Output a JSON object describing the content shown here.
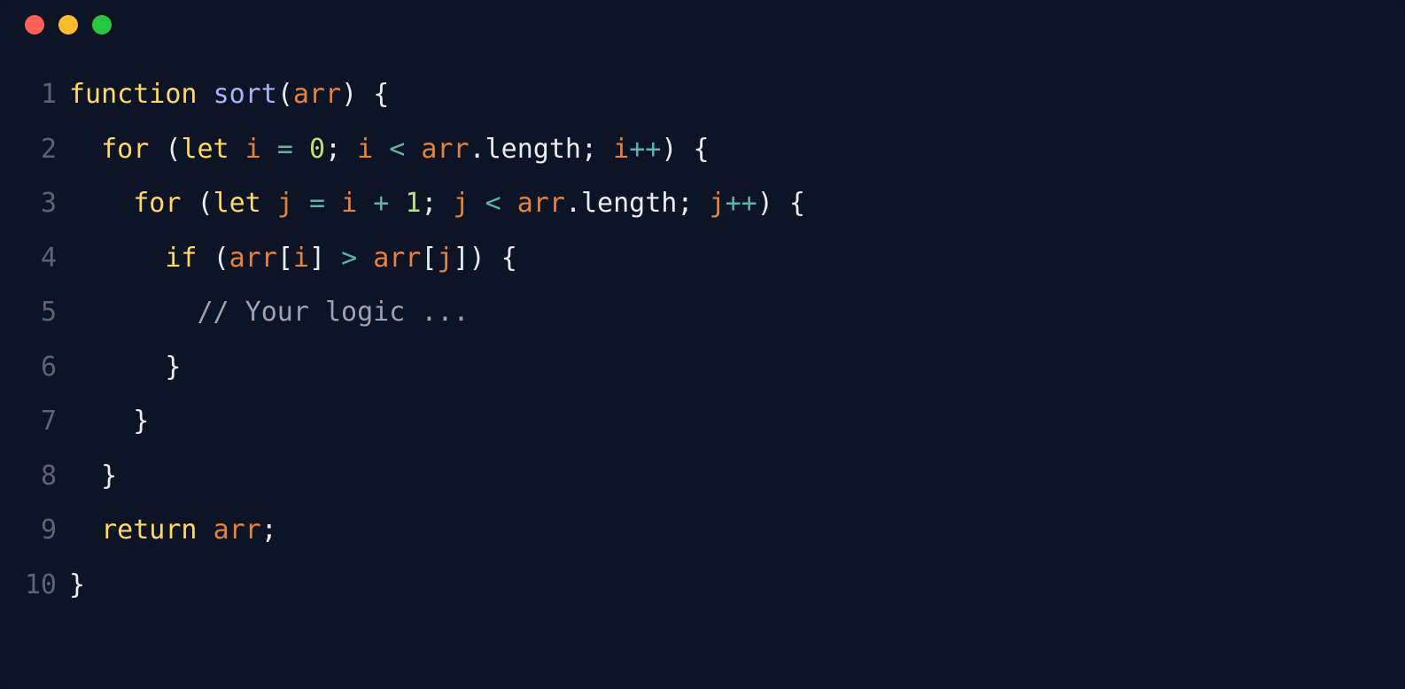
{
  "traffic": {
    "red": "#ff5f57",
    "yellow": "#febc2e",
    "green": "#28c840"
  },
  "lineNumbers": [
    "1",
    "2",
    "3",
    "4",
    "5",
    "6",
    "7",
    "8",
    "9",
    "10"
  ],
  "code": {
    "l1": {
      "function": "function",
      "sp1": " ",
      "name": "sort",
      "lp": "(",
      "arg": "arr",
      "rp": ")",
      "sp2": " ",
      "brace": "{"
    },
    "l2": {
      "indent": "  ",
      "for": "for",
      "sp1": " ",
      "lp": "(",
      "let": "let",
      "sp2": " ",
      "i1": "i",
      "sp3": " ",
      "eq": "=",
      "sp4": " ",
      "zero": "0",
      "semi1": ";",
      "sp5": " ",
      "i2": "i",
      "sp6": " ",
      "lt": "<",
      "sp7": " ",
      "arr": "arr",
      "dot": ".",
      "len": "length",
      "semi2": ";",
      "sp8": " ",
      "i3": "i",
      "inc": "++",
      "rp": ")",
      "sp9": " ",
      "brace": "{"
    },
    "l3": {
      "indent": "    ",
      "for": "for",
      "sp1": " ",
      "lp": "(",
      "let": "let",
      "sp2": " ",
      "j1": "j",
      "sp3": " ",
      "eq": "=",
      "sp4": " ",
      "i": "i",
      "sp5": " ",
      "plus": "+",
      "sp6": " ",
      "one": "1",
      "semi1": ";",
      "sp7": " ",
      "j2": "j",
      "sp8": " ",
      "lt": "<",
      "sp9": " ",
      "arr": "arr",
      "dot": ".",
      "len": "length",
      "semi2": ";",
      "sp10": " ",
      "j3": "j",
      "inc": "++",
      "rp": ")",
      "sp11": " ",
      "brace": "{"
    },
    "l4": {
      "indent": "      ",
      "if": "if",
      "sp1": " ",
      "lp": "(",
      "arr1": "arr",
      "lb1": "[",
      "i": "i",
      "rb1": "]",
      "sp2": " ",
      "gt": ">",
      "sp3": " ",
      "arr2": "arr",
      "lb2": "[",
      "j": "j",
      "rb2": "]",
      "rp": ")",
      "sp4": " ",
      "brace": "{"
    },
    "l5": {
      "indent": "        ",
      "comment": "// Your logic ..."
    },
    "l6": {
      "indent": "      ",
      "brace": "}"
    },
    "l7": {
      "indent": "    ",
      "brace": "}"
    },
    "l8": {
      "indent": "  ",
      "brace": "}"
    },
    "l9": {
      "indent": "  ",
      "return": "return",
      "sp": " ",
      "arr": "arr",
      "semi": ";"
    },
    "l10": {
      "brace": "}"
    }
  }
}
